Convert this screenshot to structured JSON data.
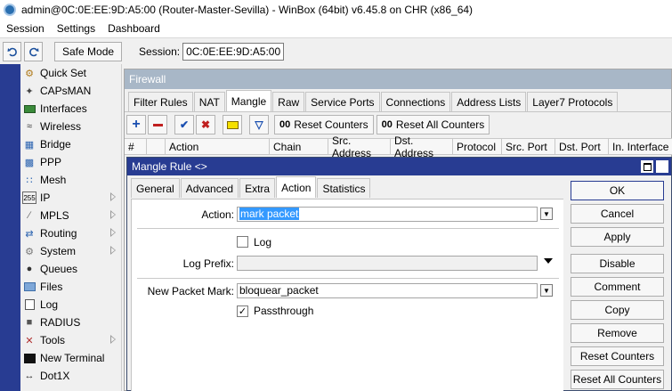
{
  "window": {
    "title": "admin@0C:0E:EE:9D:A5:00 (Router-Master-Sevilla) - WinBox (64bit) v6.45.8 on CHR (x86_64)"
  },
  "menu": [
    "Session",
    "Settings",
    "Dashboard"
  ],
  "toolbar": {
    "safe_mode": "Safe Mode",
    "session_label": "Session:",
    "session_value": "0C:0E:EE:9D:A5:00"
  },
  "sidebar": {
    "items": [
      {
        "label": "Quick Set",
        "icon": "quick-set-icon"
      },
      {
        "label": "CAPsMAN",
        "icon": "capsman-icon"
      },
      {
        "label": "Interfaces",
        "icon": "interfaces-icon"
      },
      {
        "label": "Wireless",
        "icon": "wireless-icon"
      },
      {
        "label": "Bridge",
        "icon": "bridge-icon"
      },
      {
        "label": "PPP",
        "icon": "ppp-icon"
      },
      {
        "label": "Mesh",
        "icon": "mesh-icon"
      },
      {
        "label": "IP",
        "icon": "ip-icon"
      },
      {
        "label": "MPLS",
        "icon": "mpls-icon"
      },
      {
        "label": "Routing",
        "icon": "routing-icon"
      },
      {
        "label": "System",
        "icon": "system-icon"
      },
      {
        "label": "Queues",
        "icon": "queues-icon"
      },
      {
        "label": "Files",
        "icon": "files-icon"
      },
      {
        "label": "Log",
        "icon": "log-icon"
      },
      {
        "label": "RADIUS",
        "icon": "radius-icon"
      },
      {
        "label": "Tools",
        "icon": "tools-icon"
      },
      {
        "label": "New Terminal",
        "icon": "terminal-icon"
      },
      {
        "label": "Dot1X",
        "icon": "dot1x-icon"
      }
    ]
  },
  "firewall": {
    "title": "Firewall",
    "tabs": [
      "Filter Rules",
      "NAT",
      "Mangle",
      "Raw",
      "Service Ports",
      "Connections",
      "Address Lists",
      "Layer7 Protocols"
    ],
    "active_tab": "Mangle",
    "reset_counters": "Reset Counters",
    "reset_all_counters": "Reset All Counters",
    "counter_prefix": "00",
    "columns": [
      "#",
      "Action",
      "Chain",
      "Src. Address",
      "Dst. Address",
      "Protocol",
      "Src. Port",
      "Dst. Port",
      "In. Interface"
    ]
  },
  "dialog": {
    "title": "Mangle Rule <>",
    "tabs": [
      "General",
      "Advanced",
      "Extra",
      "Action",
      "Statistics"
    ],
    "active_tab": "Action",
    "action_label": "Action:",
    "action_value": "mark packet",
    "log_label": "Log",
    "log_checked": false,
    "log_prefix_label": "Log Prefix:",
    "log_prefix_value": "",
    "packet_mark_label": "New Packet Mark:",
    "packet_mark_value": "bloquear_packet",
    "passthrough_label": "Passthrough",
    "passthrough_checked": true,
    "buttons": [
      "OK",
      "Cancel",
      "Apply",
      "Disable",
      "Comment",
      "Copy",
      "Remove",
      "Reset Counters",
      "Reset All Counters"
    ]
  }
}
